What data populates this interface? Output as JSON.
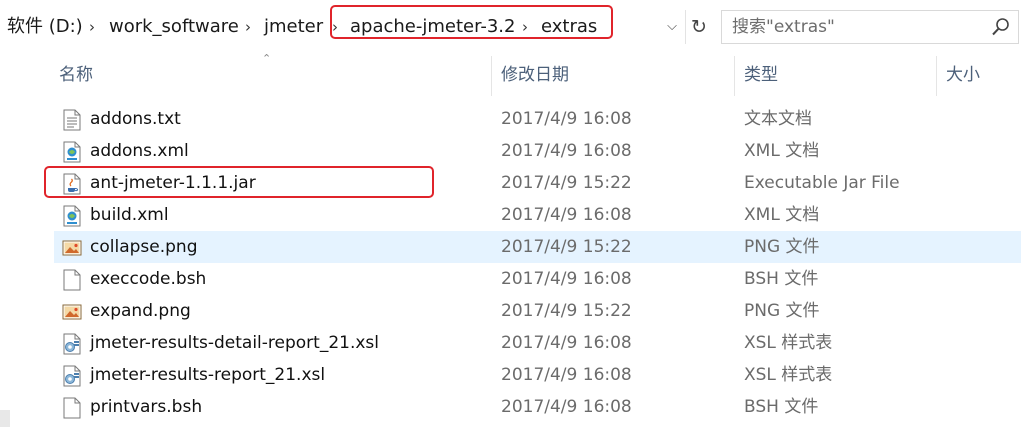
{
  "address": {
    "crumbs": [
      "软件 (D:)",
      "work_software",
      "jmeter",
      "apache-jmeter-3.2",
      "extras"
    ],
    "search_placeholder": "搜索\"extras\""
  },
  "columns": {
    "name": "名称",
    "date": "修改日期",
    "type": "类型",
    "size": "大小"
  },
  "files": [
    {
      "name": "addons.txt",
      "date": "2017/4/9 16:08",
      "type": "文本文档",
      "icon": "text-file-icon"
    },
    {
      "name": "addons.xml",
      "date": "2017/4/9 16:08",
      "type": "XML 文档",
      "icon": "xml-file-icon"
    },
    {
      "name": "ant-jmeter-1.1.1.jar",
      "date": "2017/4/9 15:22",
      "type": "Executable Jar File",
      "icon": "java-jar-icon"
    },
    {
      "name": "build.xml",
      "date": "2017/4/9 16:08",
      "type": "XML 文档",
      "icon": "xml-file-icon"
    },
    {
      "name": "collapse.png",
      "date": "2017/4/9 15:22",
      "type": "PNG 文件",
      "icon": "png-image-icon"
    },
    {
      "name": "execcode.bsh",
      "date": "2017/4/9 16:08",
      "type": "BSH 文件",
      "icon": "blank-file-icon"
    },
    {
      "name": "expand.png",
      "date": "2017/4/9 15:22",
      "type": "PNG 文件",
      "icon": "png-image-icon"
    },
    {
      "name": "jmeter-results-detail-report_21.xsl",
      "date": "2017/4/9 16:08",
      "type": "XSL 样式表",
      "icon": "xsl-file-icon"
    },
    {
      "name": "jmeter-results-report_21.xsl",
      "date": "2017/4/9 16:08",
      "type": "XSL 样式表",
      "icon": "xsl-file-icon"
    },
    {
      "name": "printvars.bsh",
      "date": "2017/4/9 16:08",
      "type": "BSH 文件",
      "icon": "blank-file-icon"
    }
  ],
  "selected_index": 4,
  "highlight_color": "#e0242b",
  "selected_color": "#e5f3ff"
}
